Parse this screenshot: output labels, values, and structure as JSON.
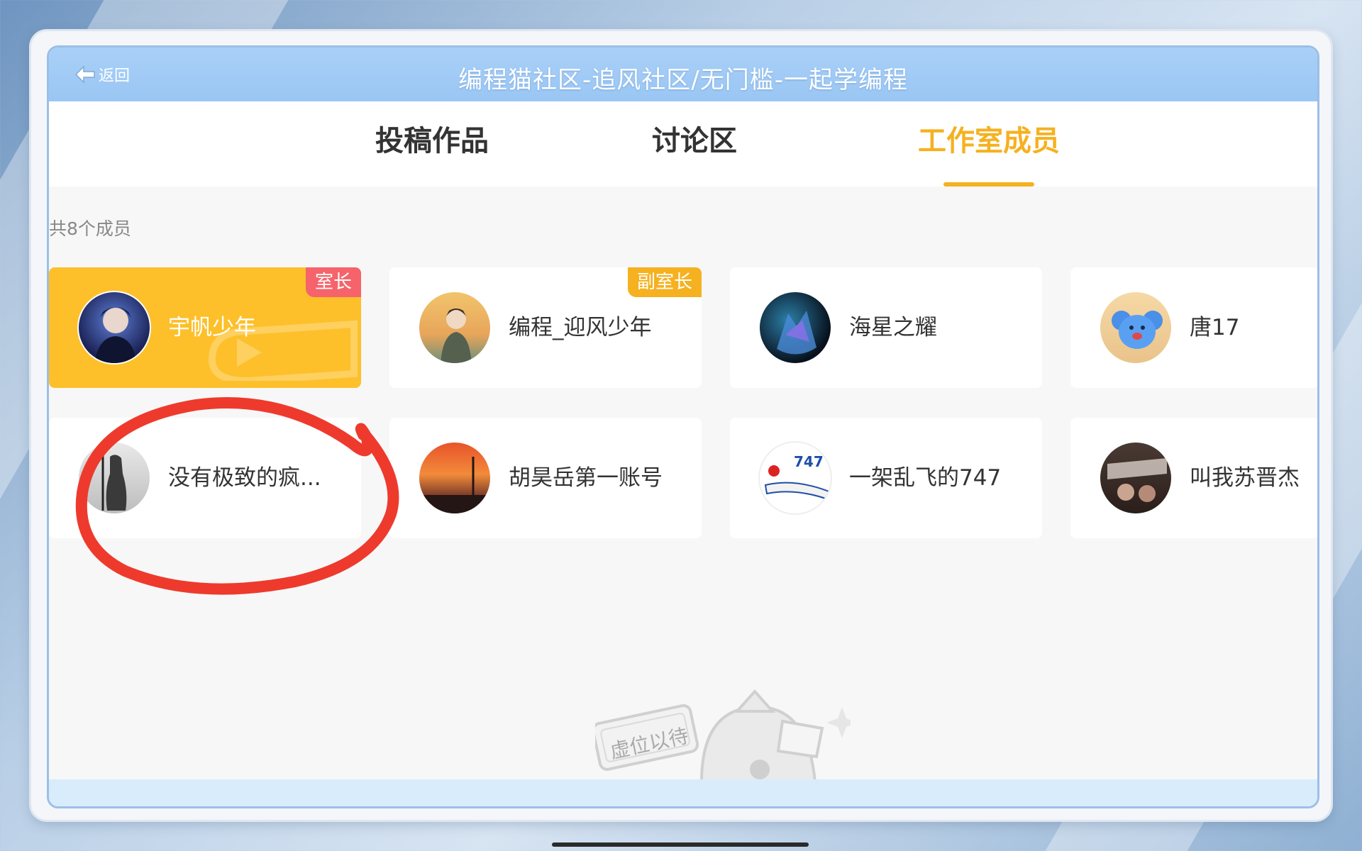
{
  "header": {
    "back_label": "返回",
    "title": "编程猫社区-追风社区/无门槛-一起学编程"
  },
  "tabs": [
    {
      "label": "投稿作品",
      "active": false
    },
    {
      "label": "讨论区",
      "active": false
    },
    {
      "label": "工作室成员",
      "active": true
    }
  ],
  "member_count": "共8个成员",
  "members": [
    {
      "name": "宇帆少年",
      "badge": "室长",
      "badge_color": "#f6636a",
      "highlight": true,
      "avatar": "anime-boy-avatar"
    },
    {
      "name": "编程_迎风少年",
      "badge": "副室长",
      "badge_color": "#f5b120",
      "highlight": false,
      "avatar": "anime-sky-avatar"
    },
    {
      "name": "海星之耀",
      "badge": "",
      "highlight": false,
      "avatar": "wolf-avatar"
    },
    {
      "name": "唐17",
      "badge": "",
      "highlight": false,
      "avatar": "koala-avatar"
    },
    {
      "name": "没有极致的疯...",
      "badge": "",
      "highlight": false,
      "avatar": "ink-figure-avatar"
    },
    {
      "name": "胡昊岳第一账号",
      "badge": "",
      "highlight": false,
      "avatar": "sunset-avatar"
    },
    {
      "name": "一架乱飞的747",
      "badge": "",
      "highlight": false,
      "avatar": "airplane-avatar"
    },
    {
      "name": "叫我苏晋杰",
      "badge": "",
      "highlight": false,
      "avatar": "poster-avatar"
    }
  ],
  "placeholder_sign": "虚位以待",
  "colors": {
    "accent": "#f5b120",
    "owner_badge": "#f6636a",
    "header": "#a9d0f7",
    "annotation": "#ee3a2c"
  }
}
